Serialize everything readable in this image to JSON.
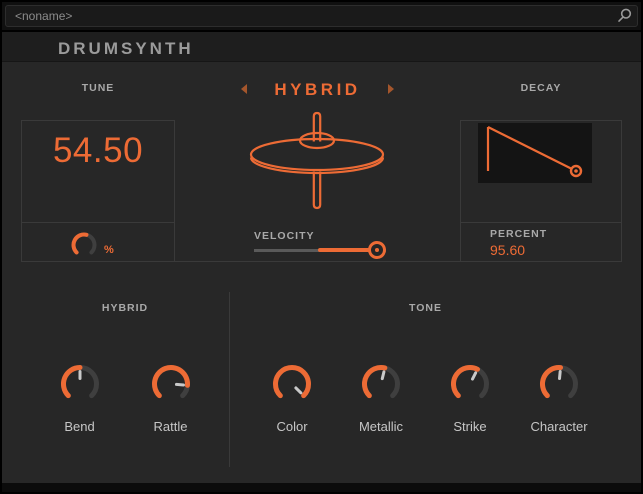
{
  "accent": "#ED6B35",
  "topbar": {
    "name": "<noname>",
    "search_icon": "magnifier"
  },
  "header": {
    "title": "DRUMSYNTH"
  },
  "engine": {
    "label": "HYBRID",
    "prev_icon": "left-arrow",
    "next_icon": "right-arrow",
    "graphic": "cymbal"
  },
  "tune": {
    "label": "TUNE",
    "value": "54.50",
    "unit": "%",
    "knob": {
      "value": 0.55
    }
  },
  "velocity": {
    "label": "VELOCITY",
    "value": 0.93,
    "fill_start": 0.485
  },
  "decay": {
    "label": "DECAY",
    "percent_label": "PERCENT",
    "percent_value": "95.60",
    "graphic": "decay-envelope"
  },
  "hybrid": {
    "label": "HYBRID",
    "knobs": [
      {
        "label": "Bend",
        "value": 0.5
      },
      {
        "label": "Rattle",
        "value": 0.85
      }
    ]
  },
  "tone": {
    "label": "TONE",
    "knobs": [
      {
        "label": "Color",
        "value": 1.0
      },
      {
        "label": "Metallic",
        "value": 0.55
      },
      {
        "label": "Strike",
        "value": 0.6
      },
      {
        "label": "Character",
        "value": 0.52
      }
    ]
  }
}
